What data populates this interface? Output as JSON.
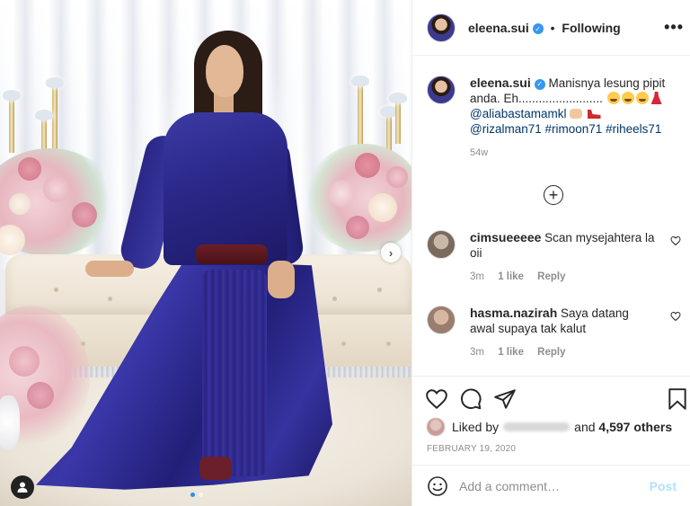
{
  "header": {
    "username": "eleena.sui",
    "separator": "•",
    "follow_status": "Following",
    "more_label": "•••"
  },
  "caption": {
    "username": "eleena.sui",
    "text_1": "Manisnya lesung pipit anda. Eh.........................",
    "mention_1": "@aliabastamamkl",
    "mention_2": "@rizalman71",
    "hashtag_1": "#rimoon71",
    "hashtag_2": "#riheels71",
    "time": "54w"
  },
  "comments": [
    {
      "username": "cimsueeeee",
      "text": "Scan mysejahtera la oii",
      "time": "3m",
      "likes": "1 like",
      "reply": "Reply"
    },
    {
      "username": "hasma.nazirah",
      "text": "Saya datang awal supaya tak kalut",
      "time": "3m",
      "likes": "1 like",
      "reply": "Reply"
    }
  ],
  "likes": {
    "prefix": "Liked by",
    "middle": "and",
    "count": "4,597 others"
  },
  "date": "FEBRUARY 19, 2020",
  "comment_box": {
    "placeholder": "Add a comment…",
    "post_label": "Post"
  },
  "photo": {
    "next_arrow": "›",
    "carousel_count": 2,
    "active_index": 0
  },
  "colors": {
    "link": "#00376b",
    "verified": "#3897f0",
    "post_disabled": "#b2dffc",
    "muted": "#8e8e8e",
    "gown": "#2a2788"
  }
}
